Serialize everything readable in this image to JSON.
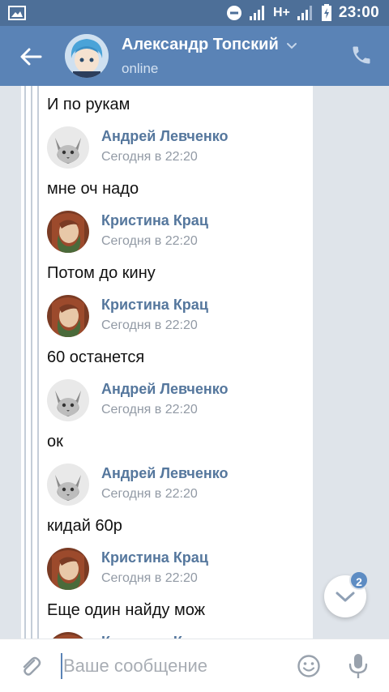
{
  "status_bar": {
    "time": "23:00",
    "network": "H+"
  },
  "header": {
    "name": "Александр Топский",
    "status": "online",
    "accent": "#5a83b6"
  },
  "messages": [
    {
      "type": "text",
      "text": "И по рукам"
    },
    {
      "type": "author",
      "name": "Андрей Левченко",
      "date": "Сегодня в 22:20",
      "avatar": "cat-avatar"
    },
    {
      "type": "text",
      "text": "мне оч надо"
    },
    {
      "type": "author",
      "name": "Кристина Крац",
      "date": "Сегодня в 22:20",
      "avatar": "girl-avatar"
    },
    {
      "type": "text",
      "text": "Потом до кину"
    },
    {
      "type": "author",
      "name": "Кристина Крац",
      "date": "Сегодня в 22:20",
      "avatar": "girl-avatar"
    },
    {
      "type": "text",
      "text": "60 останется"
    },
    {
      "type": "author",
      "name": "Андрей Левченко",
      "date": "Сегодня в 22:20",
      "avatar": "cat-avatar"
    },
    {
      "type": "text",
      "text": "ок"
    },
    {
      "type": "author",
      "name": "Андрей Левченко",
      "date": "Сегодня в 22:20",
      "avatar": "cat-avatar"
    },
    {
      "type": "text",
      "text": "кидай 60р"
    },
    {
      "type": "author",
      "name": "Кристина Крац",
      "date": "Сегодня в 22:20",
      "avatar": "girl-avatar"
    },
    {
      "type": "text",
      "text": "Еще один найду мож"
    },
    {
      "type": "author",
      "name": "Кристина Крац",
      "date": "",
      "avatar": "girl-avatar"
    }
  ],
  "scroll_badge": "2",
  "composer": {
    "placeholder": "Ваше сообщение"
  }
}
